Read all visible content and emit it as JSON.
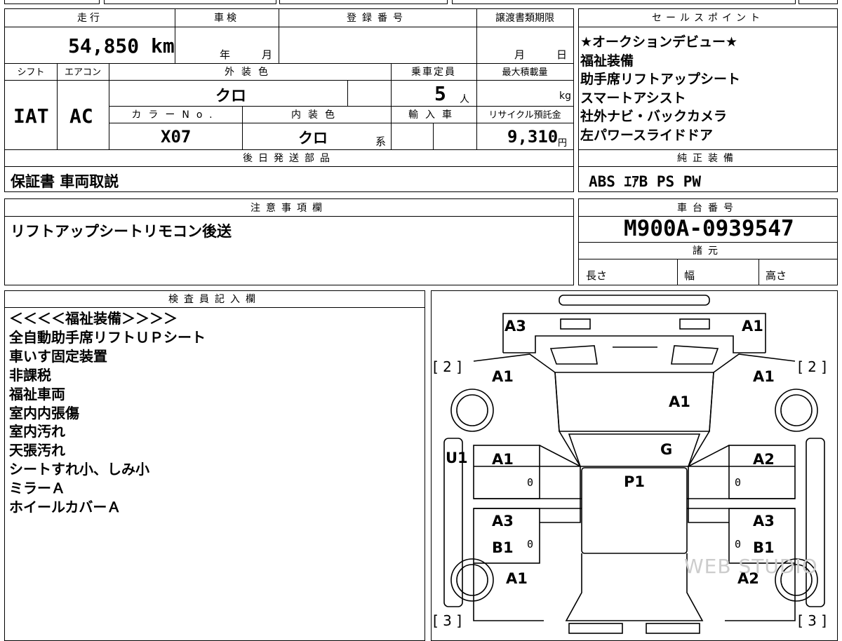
{
  "mileage": {
    "label": "走行",
    "value": "54,850 km"
  },
  "inspection": {
    "label": "車検",
    "year_unit": "年",
    "month_unit": "月"
  },
  "registration": {
    "label": "登録番号"
  },
  "transfer_deadline": {
    "label": "譲渡書類期限",
    "month_unit": "月",
    "day_unit": "日"
  },
  "shift": {
    "label": "シフト",
    "value": "IAT"
  },
  "aircon": {
    "label": "エアコン",
    "value": "AC"
  },
  "exterior_color": {
    "label": "外装色",
    "value": "クロ"
  },
  "capacity": {
    "label": "乗車定員",
    "value": "5",
    "unit": "人"
  },
  "max_load": {
    "label": "最大積載量",
    "unit": "kg"
  },
  "color_no": {
    "label": "カラーNo.",
    "value": "X07"
  },
  "interior_color": {
    "label": "内装色",
    "value": "クロ",
    "unit": "系"
  },
  "import": {
    "label": "輸入車"
  },
  "recycle": {
    "label": "リサイクル預託金",
    "value": "9,310",
    "unit": "円"
  },
  "later_parts": {
    "label": "後日発送部品",
    "value": "保証書 車両取説"
  },
  "sales_points": {
    "label": "セールスポイント",
    "items": [
      "★オークションデビュー★",
      "福祉装備",
      "助手席リフトアップシート",
      "スマートアシスト",
      "社外ナビ・バックカメラ",
      "左パワースライドドア"
    ]
  },
  "genuine_equipment": {
    "label": "純正装備",
    "value": "ABS ｴｱB PS PW"
  },
  "notes": {
    "label": "注意事項欄",
    "value": "リフトアップシートリモコン後送"
  },
  "chassis": {
    "label": "車台番号",
    "value": "M900A-0939547"
  },
  "specs": {
    "label": "諸元",
    "length": "長さ",
    "width": "幅",
    "height": "高さ"
  },
  "inspector": {
    "label": "検査員記入欄",
    "lines": [
      "＜＜＜＜福祉装備＞＞＞＞",
      "全自動助手席リフトＵＰシート",
      "車いす固定装置",
      "非課税",
      "福祉車両",
      "室内内張傷",
      "室内汚れ",
      "天張汚れ",
      "シートすれ小、しみ小",
      "ミラーＡ",
      "ホイールカバーＡ"
    ]
  },
  "diagram": {
    "bracket_top_left": "[ 2 ]",
    "bracket_top_right": "[ 2 ]",
    "bracket_bottom_left": "[ 3 ]",
    "bracket_bottom_right": "[ 3 ]",
    "codes": {
      "front_left": "A3",
      "front_right": "A1",
      "fender_left": "A1",
      "fender_right": "A1",
      "hood": "A1",
      "windshield": "G",
      "mirror_left": "U1",
      "door_fl": "A1",
      "door_fr": "A2",
      "roof": "P1",
      "door_rl_1": "A3",
      "door_rl_2": "B1",
      "door_rr_1": "A3",
      "door_rr_2": "B1",
      "quarter_left": "A1",
      "quarter_right": "A2"
    },
    "zero": "0",
    "watermark": "WEB STUDIO"
  }
}
